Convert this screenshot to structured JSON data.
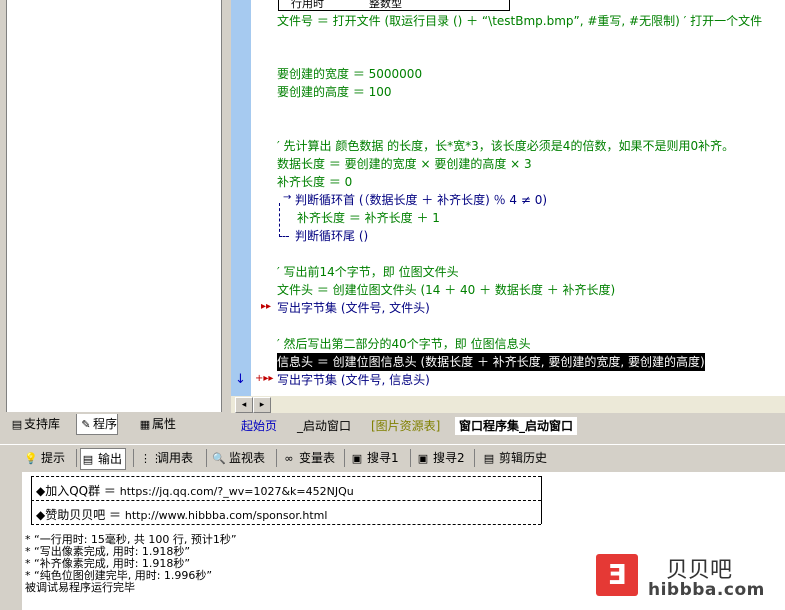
{
  "left_panel": {
    "tabs": [
      {
        "label": "支持库",
        "icon": "library-icon"
      },
      {
        "label": "程序",
        "icon": "program-icon"
      },
      {
        "label": "属性",
        "icon": "property-icon"
      }
    ]
  },
  "code": {
    "table_top_cells": [
      "行用时",
      "整数型"
    ],
    "lines": [
      {
        "text": "文件号 ＝ 打开文件 (取运行目录 () ＋ “\\testBmp.bmp”, #重写, #无限制) ′ 打开一个文件"
      },
      {
        "text": "要创建的宽度 ＝ 5000000"
      },
      {
        "text": "要创建的高度 ＝ 100"
      },
      {
        "text": "′ 先计算出 颜色数据 的长度，长*宽*3，该长度必须是4的倍数，如果不是则用0补齐。"
      },
      {
        "text": "数据长度 ＝ 要创建的宽度 × 要创建的高度 × 3"
      },
      {
        "text": "补齐长度 ＝ 0"
      },
      {
        "text": "判断循环首 (（数据长度 ＋ 补齐长度) ％ 4 ≠ 0)"
      },
      {
        "text": "补齐长度 ＝ 补齐长度 ＋ 1"
      },
      {
        "text": "判断循环尾 ()"
      },
      {
        "text": "′ 写出前14个字节，即 位图文件头"
      },
      {
        "text": "文件头 ＝ 创建位图文件头 (14 ＋ 40 ＋ 数据长度 ＋ 补齐长度)"
      },
      {
        "text": "写出字节集 (文件号, 文件头)"
      },
      {
        "text": "′ 然后写出第二部分的40个字节，即  位图信息头"
      },
      {
        "text": "信息头 ＝ 创建位图信息头 (数据长度 ＋ 补齐长度, 要创建的宽度, 要创建的高度)"
      },
      {
        "text": "写出字节集 (文件号, 信息头)"
      }
    ]
  },
  "editor_tabs": [
    {
      "label": "起始页"
    },
    {
      "label": "_启动窗口"
    },
    {
      "label": "[图片资源表]"
    },
    {
      "label": "窗口程序集_启动窗口"
    }
  ],
  "bottom_tabs": [
    {
      "label": "提示",
      "icon": "hint-icon"
    },
    {
      "label": "输出",
      "icon": "output-icon"
    },
    {
      "label": "调用表",
      "icon": "call-table-icon"
    },
    {
      "label": "监视表",
      "icon": "watch-icon"
    },
    {
      "label": "变量表",
      "icon": "variable-icon"
    },
    {
      "label": "搜寻1",
      "icon": "search1-icon"
    },
    {
      "label": "搜寻2",
      "icon": "search2-icon"
    },
    {
      "label": "剪辑历史",
      "icon": "clip-history-icon"
    }
  ],
  "output": {
    "qq_label": "◆加入QQ群 ＝",
    "qq_url": "https://jq.qq.com/?_wv=1027&k=452NJQu",
    "sponsor_label": "◆赞助贝贝吧 ＝",
    "sponsor_url": "http://www.hibbba.com/sponsor.html",
    "lines": [
      "* “一行用时: 15毫秒, 共 100 行, 预计1秒”",
      "* “写出像素完成, 用时: 1.918秒”",
      "* “补齐像素完成, 用时: 1.918秒”",
      "* “纯色位图创建完毕, 用时: 1.996秒”",
      "被调试易程序运行完毕"
    ]
  },
  "watermark": {
    "name": "贝贝吧",
    "url": "hibbba.com"
  },
  "colors": {
    "code_green": "#008000",
    "code_blue": "#000080",
    "gutter": "#a6caf0",
    "selection": "#000000",
    "logo_red": "#e53935"
  }
}
